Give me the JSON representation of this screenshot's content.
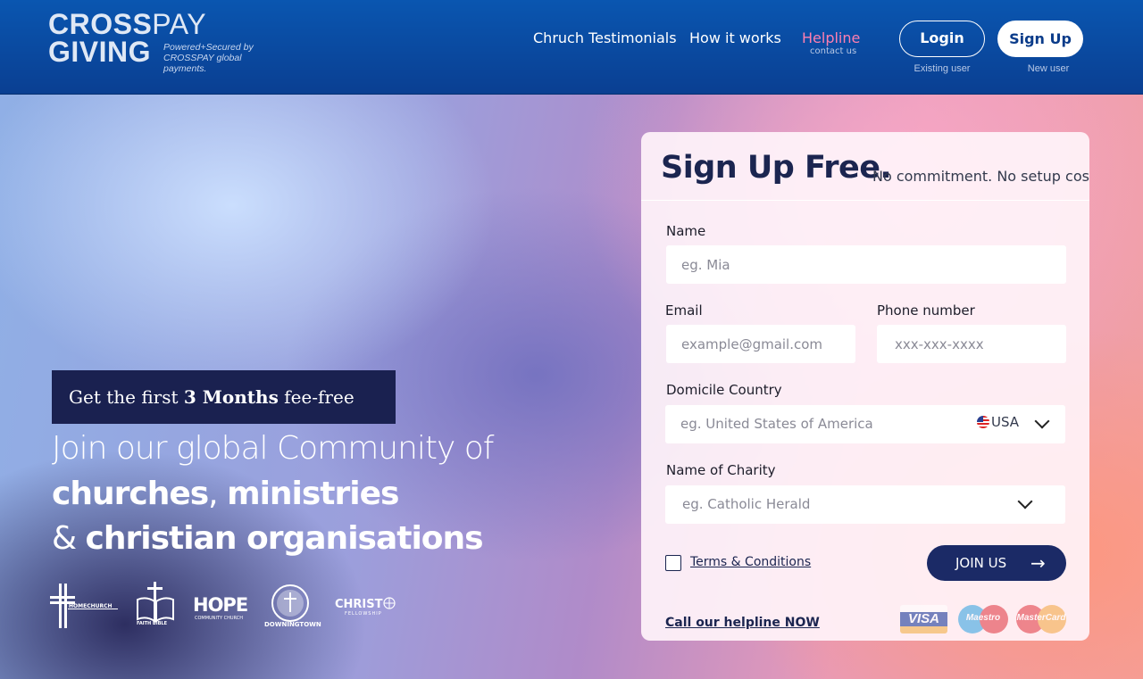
{
  "header": {
    "logo_line1_bold": "CROSS",
    "logo_line1_light": "PAY",
    "logo_line2": "GIVING",
    "logo_tagline": "Powered+Secured by CROSSPAY global payments.",
    "nav": {
      "testimonials": "Chruch Testimonials",
      "how_it_works": "How it works",
      "helpline": "Helpline",
      "helpline_sub": "contact us"
    },
    "login_label": "Login",
    "login_caption": "Existing user",
    "signup_label": "Sign Up",
    "signup_caption": "New user"
  },
  "hero": {
    "promo_pre": "Get the first ",
    "promo_bold": "3 Months",
    "promo_post": " fee-free",
    "line1": "Join our global Community of",
    "line2_a": "churches",
    "line2_sep": ", ",
    "line2_b": "ministries",
    "line3_amp": "& ",
    "line3_b": "christian organisations",
    "orgs": {
      "homechurch": "HOMECHURCH",
      "faith_bible": "FAITH BIBLE",
      "hope": "HOPE",
      "hope_sub": "COMMUNITY CHURCH",
      "downingtown": "DOWNINGTOWN",
      "christ": "CHRIST",
      "christ_sub": "FELLOWSHIP"
    }
  },
  "form": {
    "title": "Sign Up Free.",
    "subtitle": "No commitment. No setup cost.",
    "name_label": "Name",
    "name_placeholder": "eg. Mia",
    "email_label": "Email",
    "email_placeholder": "example@gmail.com",
    "phone_label": "Phone number",
    "phone_placeholder": "xxx-xxx-xxxx",
    "country_label": "Domicile Country",
    "country_placeholder": "eg. United States of America",
    "country_code": "USA",
    "charity_label": "Name of Charity",
    "charity_placeholder": "eg. Catholic Herald",
    "terms_label": "Terms & Conditions",
    "join_label": "JOIN US",
    "join_arrow": "→",
    "helpline_link": "Call our helpline NOW",
    "payments": {
      "visa": "VISA",
      "maestro": "Maestro",
      "mastercard": "MasterCard"
    }
  }
}
